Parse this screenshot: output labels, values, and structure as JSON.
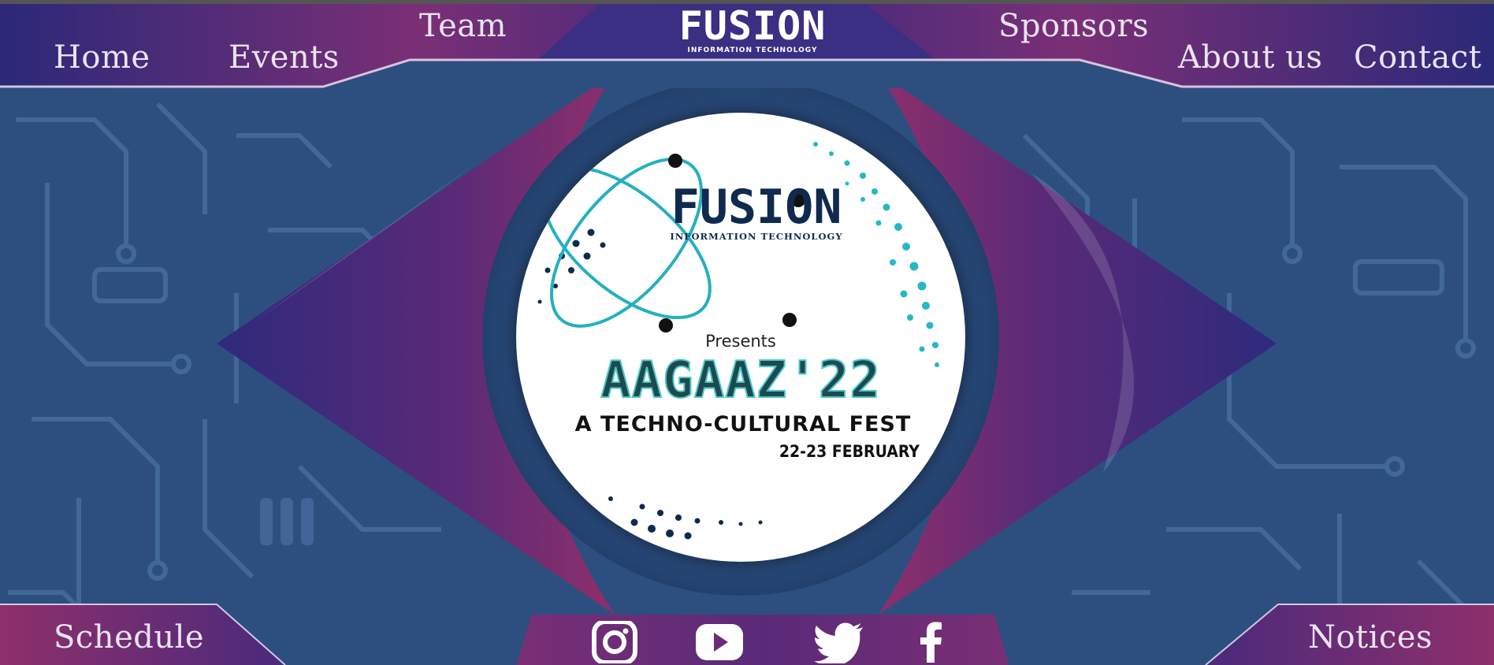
{
  "nav": {
    "home": "Home",
    "events": "Events",
    "team": "Team",
    "sponsors": "Sponsors",
    "about": "About us",
    "contact": "Contact"
  },
  "brand": {
    "name": "FUSION",
    "subtitle": "INFORMATION TECHNOLOGY"
  },
  "poster": {
    "logo_name": "FUSION",
    "logo_subtitle": "INFORMATION TECHNOLOGY",
    "presents": "Presents",
    "event_title": "AAGAAZ'22",
    "tagline": "A TECHNO-CULTURAL FEST",
    "dates": "22-23 FEBRUARY"
  },
  "bottom": {
    "schedule": "Schedule",
    "notices": "Notices"
  },
  "social": {
    "icons": [
      "instagram-icon",
      "youtube-icon",
      "twitter-icon",
      "facebook-icon"
    ]
  },
  "colors": {
    "nav_bar": "#3a2a7e",
    "magenta": "#8e2f6b",
    "background": "#2c4f80",
    "text": "#e9e3ef"
  }
}
